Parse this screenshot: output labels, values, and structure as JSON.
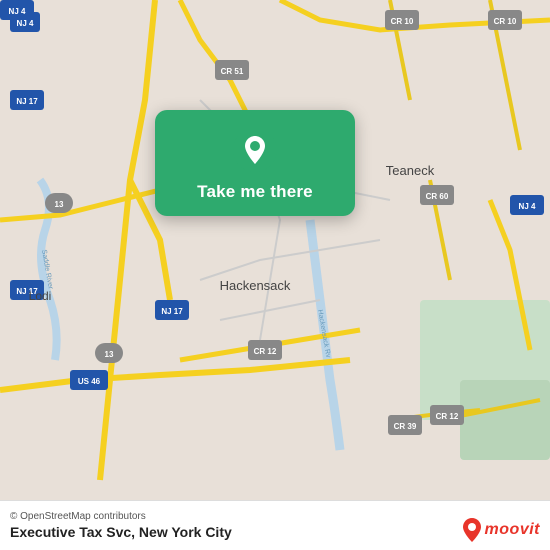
{
  "map": {
    "background_color": "#e8e0d8",
    "card": {
      "label": "Take me there",
      "bg_color": "#2eaa6e"
    }
  },
  "bottom_bar": {
    "osm_credit": "© OpenStreetMap contributors",
    "location_label": "Executive Tax Svc, New York City"
  },
  "moovit": {
    "text": "moovit"
  }
}
